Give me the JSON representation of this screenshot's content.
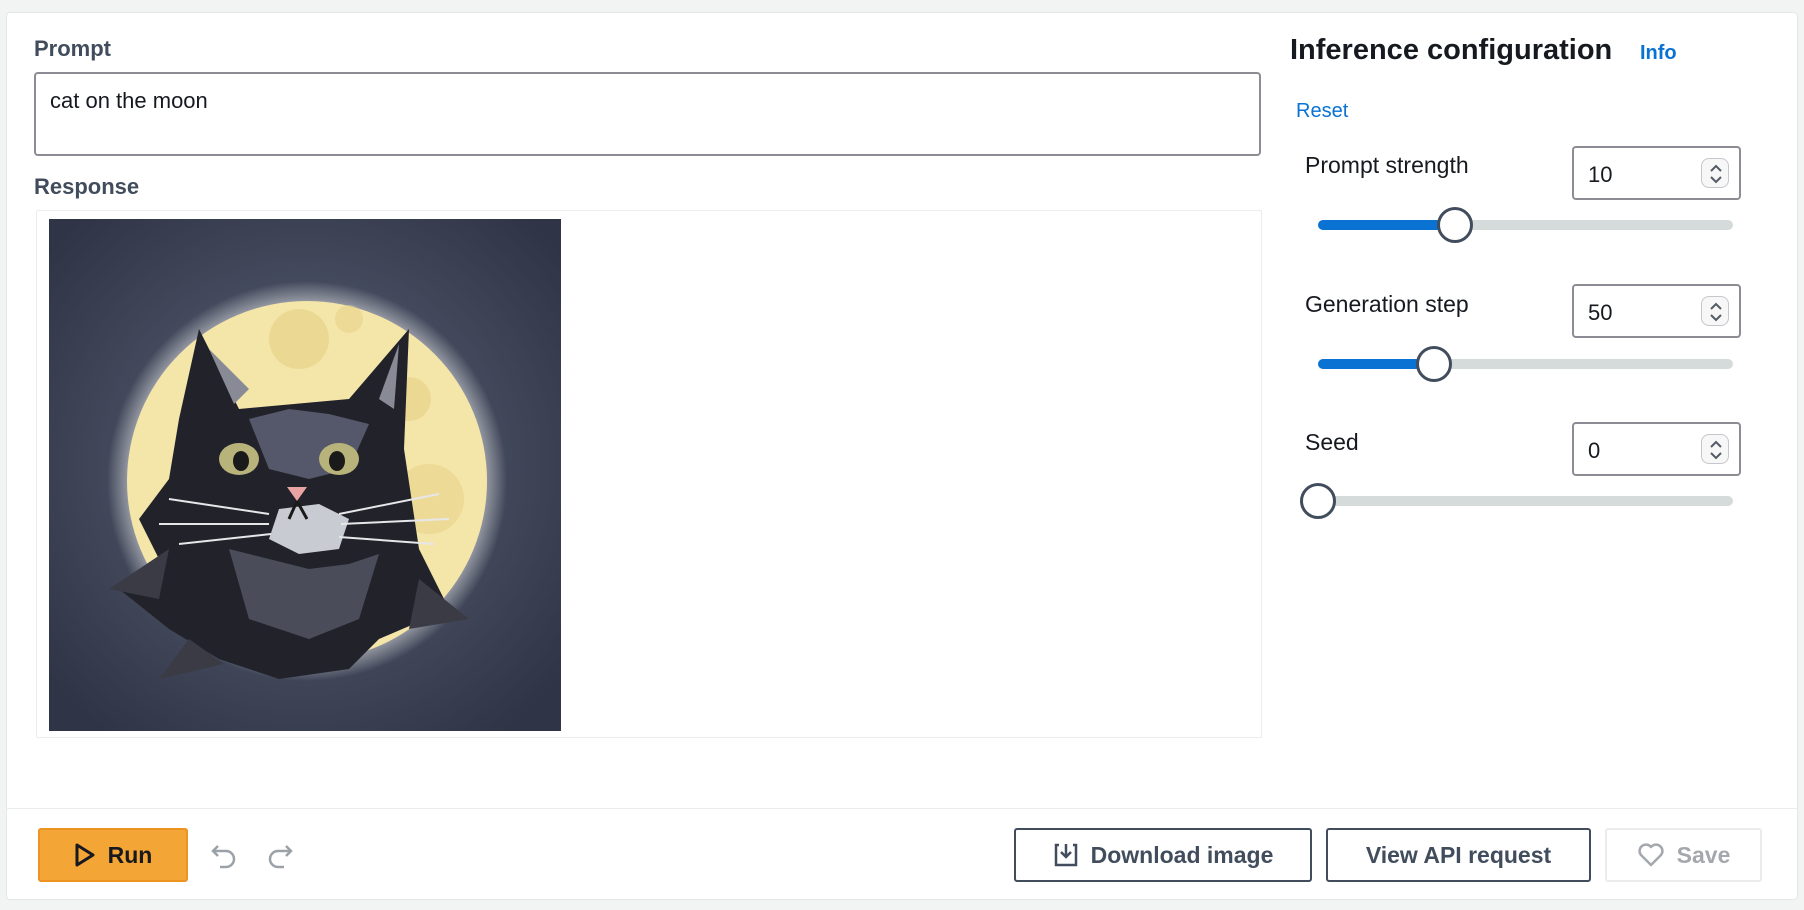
{
  "prompt": {
    "label": "Prompt",
    "value": "cat on the moon"
  },
  "response": {
    "label": "Response"
  },
  "config": {
    "title": "Inference configuration",
    "info_link": "Info",
    "reset_link": "Reset",
    "params": [
      {
        "label": "Prompt strength",
        "value": "10",
        "slider_fraction": 0.33
      },
      {
        "label": "Generation step",
        "value": "50",
        "slider_fraction": 0.28
      },
      {
        "label": "Seed",
        "value": "0",
        "slider_fraction": 0.0
      }
    ]
  },
  "footer": {
    "run_label": "Run",
    "download_label": "Download image",
    "api_label": "View API request",
    "save_label": "Save"
  },
  "colors": {
    "accent": "#0972d3",
    "run_button": "#f3a536"
  }
}
